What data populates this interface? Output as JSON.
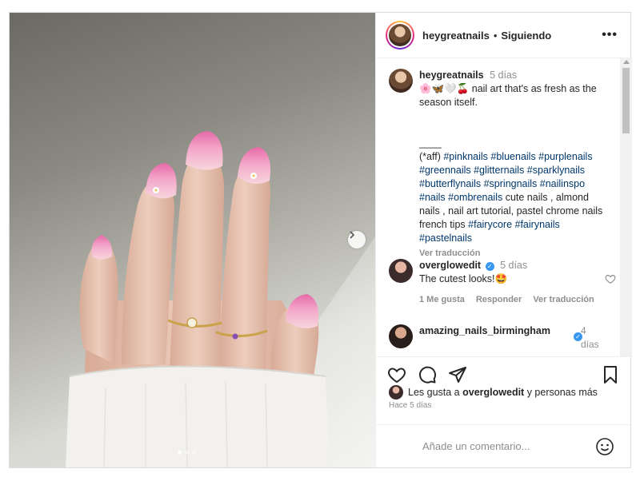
{
  "post": {
    "account": "heygreatnails",
    "separator": "•",
    "follow_state": "Siguiendo",
    "more_label": "•••",
    "caption": {
      "username": "heygreatnails",
      "time": "5 días",
      "emojis": "🌸🦋🤍🍒",
      "text_line": " nail art that's as fresh as the season itself.",
      "divider": "____",
      "aff": "(*aff) ",
      "tags_1": "#pinknails #bluenails #purplenails #greennails #glitternails #sparklynails #butterflynails #springnails #nailinspo #nails #ombrenails",
      "plain": " cute nails , almond nails , nail art tutorial, pastel chrome nails french tips ",
      "tags_2": "#fairycore #fairynails #pastelnails",
      "translate": "Ver traducción"
    },
    "comments": [
      {
        "username": "overglowedit",
        "verified": "✓",
        "time": "5 días",
        "text": "The cutest looks!🤩",
        "likes": "1 Me gusta",
        "reply": "Responder",
        "translate": "Ver traducción"
      },
      {
        "username": "amazing_nails_birmingham",
        "verified": "✓",
        "time": "4 días"
      }
    ],
    "likes_text": "Les gusta a ",
    "likes_user": "overglowedit",
    "likes_rest": " y personas más",
    "ago": "Hace 5 días",
    "comment_placeholder": "Añade un comentario...",
    "carousel": {
      "slides": 3,
      "active": 1
    },
    "icons": [
      "heart-icon",
      "comment-icon",
      "share-icon",
      "bookmark-icon",
      "emoji-icon",
      "chevron-right-icon",
      "more-icon"
    ]
  }
}
